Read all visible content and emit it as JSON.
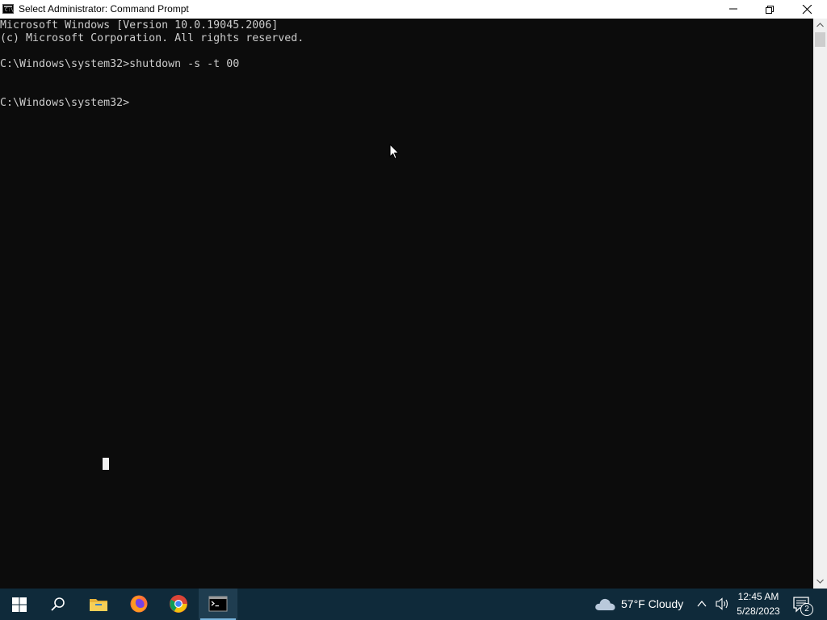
{
  "window": {
    "title": "Select Administrator:  Command Prompt",
    "app_icon_text": "C:\\",
    "controls": [
      "minimize",
      "restore",
      "close"
    ]
  },
  "console": {
    "lines": [
      "Microsoft Windows [Version 10.0.19045.2006]",
      "(c) Microsoft Corporation. All rights reserved.",
      "",
      "C:\\Windows\\system32>shutdown -s -t 00",
      "",
      "",
      "C:\\Windows\\system32>"
    ]
  },
  "taskbar": {
    "apps": [
      {
        "name": "start",
        "icon": "windows-logo-icon"
      },
      {
        "name": "search",
        "icon": "search-icon"
      },
      {
        "name": "file-explorer",
        "icon": "folder-icon"
      },
      {
        "name": "firefox",
        "icon": "firefox-icon"
      },
      {
        "name": "chrome",
        "icon": "chrome-icon"
      },
      {
        "name": "command-prompt",
        "icon": "terminal-icon",
        "active": true
      }
    ],
    "weather": {
      "temperature": "57°F",
      "condition": "Cloudy",
      "icon": "cloud-icon"
    },
    "clock": {
      "time": "12:45 AM",
      "date": "5/28/2023"
    },
    "notifications": {
      "count": "2"
    }
  },
  "colors": {
    "console_bg": "#0c0c0c",
    "console_text": "#cccccc",
    "taskbar_bg": "#0f2a3a",
    "titlebar_bg": "#ffffff"
  }
}
